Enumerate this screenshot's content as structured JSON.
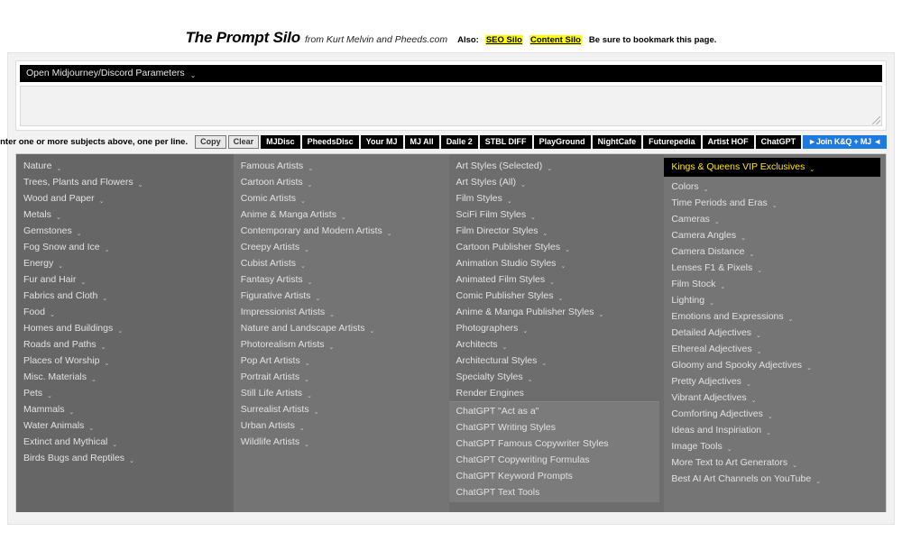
{
  "header": {
    "brand": "The Prompt Silo",
    "subtitle": "from Kurt Melvin and Pheeds.com",
    "also_label": "Also:",
    "link_seo": "SEO Silo",
    "link_content": "Content Silo",
    "bookmark_note": "Be sure to bookmark this page.",
    "highlight_color": "#ffff00"
  },
  "params": {
    "bar_label": "Open Midjourney/Discord Parameters",
    "chevron": "⌄"
  },
  "subjects": {
    "value": "",
    "placeholder": ""
  },
  "toolbar": {
    "hint": "Enter one or more subjects above, one per line.",
    "buttons": [
      {
        "label": "Copy",
        "style": "light"
      },
      {
        "label": "Clear",
        "style": "light"
      },
      {
        "label": "MJDisc",
        "style": "dark"
      },
      {
        "label": "PheedsDisc",
        "style": "dark"
      },
      {
        "label": "Your MJ",
        "style": "dark"
      },
      {
        "label": "MJ All",
        "style": "dark"
      },
      {
        "label": "Dalle 2",
        "style": "dark"
      },
      {
        "label": "STBL DIFF",
        "style": "dark"
      },
      {
        "label": "PlayGround",
        "style": "dark"
      },
      {
        "label": "NightCafe",
        "style": "dark"
      },
      {
        "label": "Futurepedia",
        "style": "dark"
      },
      {
        "label": "Artist HOF",
        "style": "dark"
      },
      {
        "label": "ChatGPT",
        "style": "dark"
      },
      {
        "label": "►Join K&Q + MJ ◄",
        "style": "blue"
      }
    ]
  },
  "menu": {
    "chevron": "⌄",
    "columns": [
      {
        "id": "col-subjects",
        "items": [
          {
            "label": "Nature",
            "chevron": true
          },
          {
            "label": "Trees, Plants and Flowers",
            "chevron": true
          },
          {
            "label": "Wood and Paper",
            "chevron": true
          },
          {
            "label": "Metals",
            "chevron": true
          },
          {
            "label": "Gemstones",
            "chevron": true
          },
          {
            "label": "Fog Snow and Ice",
            "chevron": true
          },
          {
            "label": "Energy",
            "chevron": true
          },
          {
            "label": "Fur and Hair",
            "chevron": true
          },
          {
            "label": "Fabrics and Cloth",
            "chevron": true
          },
          {
            "label": "Food",
            "chevron": true
          },
          {
            "label": "Homes and Buildings",
            "chevron": true
          },
          {
            "label": "Roads and Paths",
            "chevron": true
          },
          {
            "label": "Places of Worship",
            "chevron": true
          },
          {
            "label": "Misc. Materials",
            "chevron": true
          },
          {
            "label": "Pets",
            "chevron": true
          },
          {
            "label": "Mammals",
            "chevron": true
          },
          {
            "label": "Water Animals",
            "chevron": true
          },
          {
            "label": "Extinct and Mythical",
            "chevron": true
          },
          {
            "label": "Birds Bugs and Reptiles",
            "chevron": true
          }
        ]
      },
      {
        "id": "col-artists",
        "items": [
          {
            "label": "Famous Artists",
            "chevron": true
          },
          {
            "label": "Cartoon Artists",
            "chevron": true
          },
          {
            "label": "Comic Artists",
            "chevron": true
          },
          {
            "label": "Anime & Manga Artists",
            "chevron": true
          },
          {
            "label": "Contemporary and Modern Artists",
            "chevron": true
          },
          {
            "label": "Creepy Artists",
            "chevron": true
          },
          {
            "label": "Cubist Artists",
            "chevron": true
          },
          {
            "label": "Fantasy Artists",
            "chevron": true
          },
          {
            "label": "Figurative Artists",
            "chevron": true
          },
          {
            "label": "Impressionist Artists",
            "chevron": true
          },
          {
            "label": "Nature and Landscape Artists",
            "chevron": true
          },
          {
            "label": "Photorealism Artists",
            "chevron": true
          },
          {
            "label": "Pop Art Artists",
            "chevron": true
          },
          {
            "label": "Portrait Artists",
            "chevron": true
          },
          {
            "label": "Still Life Artists",
            "chevron": true
          },
          {
            "label": "Surrealist Artists",
            "chevron": true
          },
          {
            "label": "Urban Artists",
            "chevron": true
          },
          {
            "label": "Wildlife Artists",
            "chevron": true
          }
        ]
      },
      {
        "id": "col-styles",
        "items": [
          {
            "label": "Art Styles (Selected)",
            "chevron": true
          },
          {
            "label": "Art Styles (All)",
            "chevron": true
          },
          {
            "label": "Film Styles",
            "chevron": true
          },
          {
            "label": "SciFi Film Styles",
            "chevron": true
          },
          {
            "label": "Film Director Styles",
            "chevron": true
          },
          {
            "label": "Cartoon Publisher Styles",
            "chevron": true
          },
          {
            "label": "Animation Studio Styles",
            "chevron": true
          },
          {
            "label": "Animated Film Styles",
            "chevron": true
          },
          {
            "label": "Comic Publisher Styles",
            "chevron": true
          },
          {
            "label": "Anime & Manga Publisher Styles",
            "chevron": true
          },
          {
            "label": "Photographers",
            "chevron": true
          },
          {
            "label": "Architects",
            "chevron": true
          },
          {
            "label": "Architectural Styles",
            "chevron": true
          },
          {
            "label": "Specialty Styles",
            "chevron": true
          },
          {
            "label": "Render Engines",
            "chevron": false
          }
        ],
        "subgroup": [
          {
            "label": "ChatGPT \"Act as a\"",
            "chevron": false
          },
          {
            "label": "ChatGPT Writing Styles",
            "chevron": false
          },
          {
            "label": "ChatGPT Famous Copywriter Styles",
            "chevron": false
          },
          {
            "label": "ChatGPT Copywriting Formulas",
            "chevron": false
          },
          {
            "label": "ChatGPT Keyword Prompts",
            "chevron": false
          },
          {
            "label": "ChatGPT Text Tools",
            "chevron": false
          }
        ]
      },
      {
        "id": "col-modifiers",
        "items": [
          {
            "label": "Kings & Queens VIP Exclusives",
            "chevron": true,
            "highlight": true
          },
          {
            "label": "Colors",
            "chevron": true
          },
          {
            "label": "Time Periods and Eras",
            "chevron": true
          },
          {
            "label": "Cameras",
            "chevron": true
          },
          {
            "label": "Camera Angles",
            "chevron": true
          },
          {
            "label": "Camera Distance",
            "chevron": true
          },
          {
            "label": "Lenses F1 & Pixels",
            "chevron": true
          },
          {
            "label": "Film Stock",
            "chevron": true
          },
          {
            "label": "Lighting",
            "chevron": true
          },
          {
            "label": "Emotions and Expressions",
            "chevron": true
          },
          {
            "label": "Detailed Adjectives",
            "chevron": true
          },
          {
            "label": "Ethereal Adjectives",
            "chevron": true
          },
          {
            "label": "Gloomy and Spooky Adjectives",
            "chevron": true
          },
          {
            "label": "Pretty Adjectives",
            "chevron": true
          },
          {
            "label": "Vibrant Adjectives",
            "chevron": true
          },
          {
            "label": "Comforting Adjectives",
            "chevron": true
          },
          {
            "label": "Ideas and Inspiriation",
            "chevron": true
          },
          {
            "label": "Image Tools",
            "chevron": true
          },
          {
            "label": "More Text to Art Generators",
            "chevron": true
          },
          {
            "label": "Best AI Art Channels on YouTube",
            "chevron": true
          }
        ]
      }
    ]
  }
}
